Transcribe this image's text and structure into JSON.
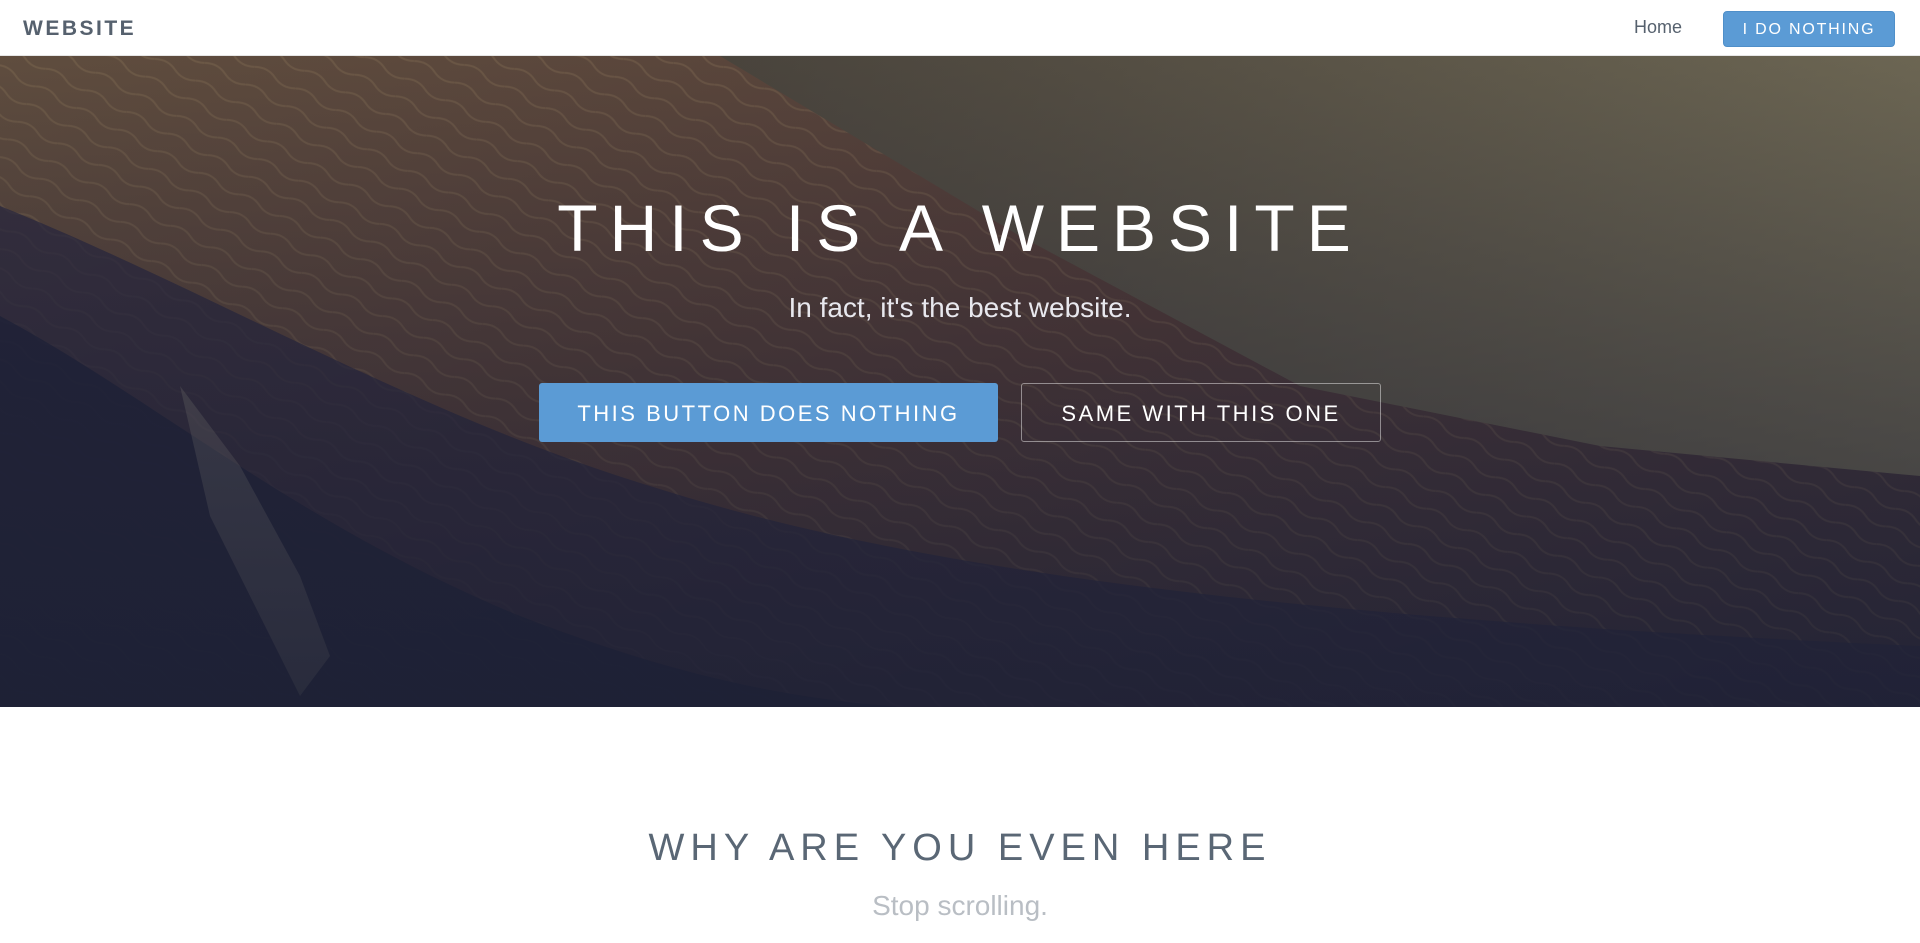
{
  "navbar": {
    "brand": "WEBSITE",
    "home_link": "Home",
    "action_button": "I DO NOTHING"
  },
  "hero": {
    "title": "THIS IS A WEBSITE",
    "subtitle": "In fact, it's the best website.",
    "primary_button": "THIS BUTTON DOES NOTHING",
    "secondary_button": "SAME WITH THIS ONE",
    "background_image": "mountain-landscape"
  },
  "section": {
    "title": "WHY ARE YOU EVEN HERE",
    "subtitle": "Stop scrolling."
  },
  "colors": {
    "accent": "#5b9bd5",
    "nav_text": "#56616e",
    "section_title": "#5a6775",
    "section_subtitle": "#b9bec4"
  }
}
